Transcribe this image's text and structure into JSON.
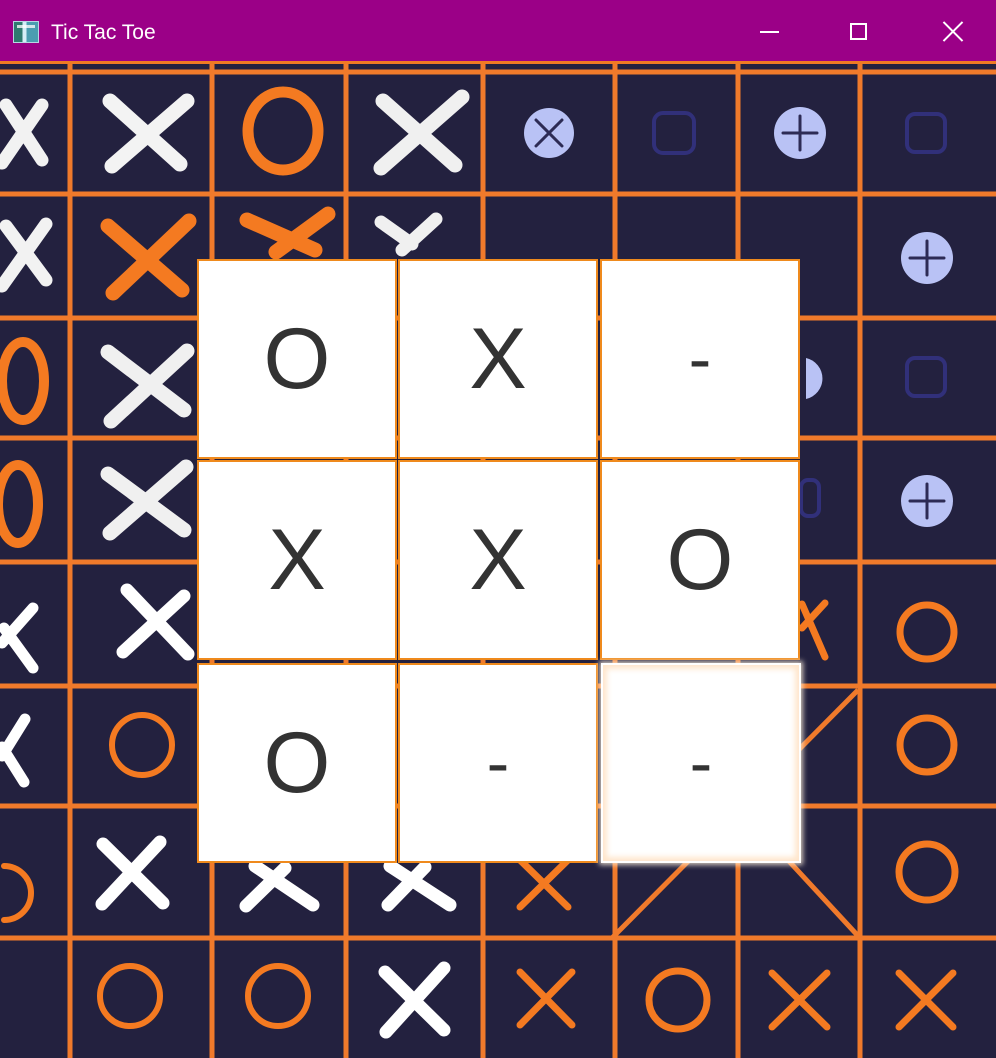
{
  "window": {
    "title": "Tic Tac Toe",
    "colors": {
      "titlebar": "#9b0087",
      "grid_line": "#ef8a1d",
      "background_art": "#23213f"
    },
    "buttons": [
      {
        "name": "minimize",
        "icon": "minimize-icon"
      },
      {
        "name": "maximize",
        "icon": "maximize-icon"
      },
      {
        "name": "close",
        "icon": "close-icon"
      }
    ]
  },
  "board": {
    "cells": [
      "O",
      "X",
      "-",
      "X",
      "X",
      "O",
      "O",
      "-",
      "-"
    ],
    "focused_cell_index": 8
  }
}
